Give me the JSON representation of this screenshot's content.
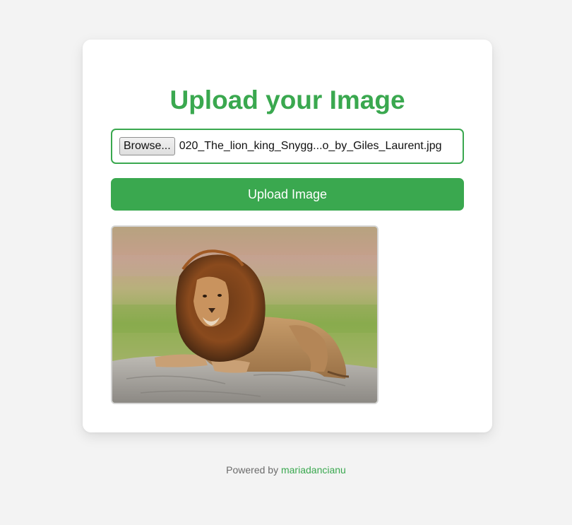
{
  "upload_form": {
    "title": "Upload your Image",
    "browse_label": "Browse...",
    "selected_file_name": "020_The_lion_king_Snygg...o_by_Giles_Laurent.jpg",
    "upload_button_label": "Upload Image"
  },
  "preview": {
    "subject": "lion"
  },
  "footer": {
    "prefix": "Powered by",
    "link_text": "mariadancianu"
  },
  "colors": {
    "accent": "#3aa84f",
    "background": "#f3f3f3",
    "card": "#ffffff",
    "footer_text": "#6b6b6b"
  }
}
